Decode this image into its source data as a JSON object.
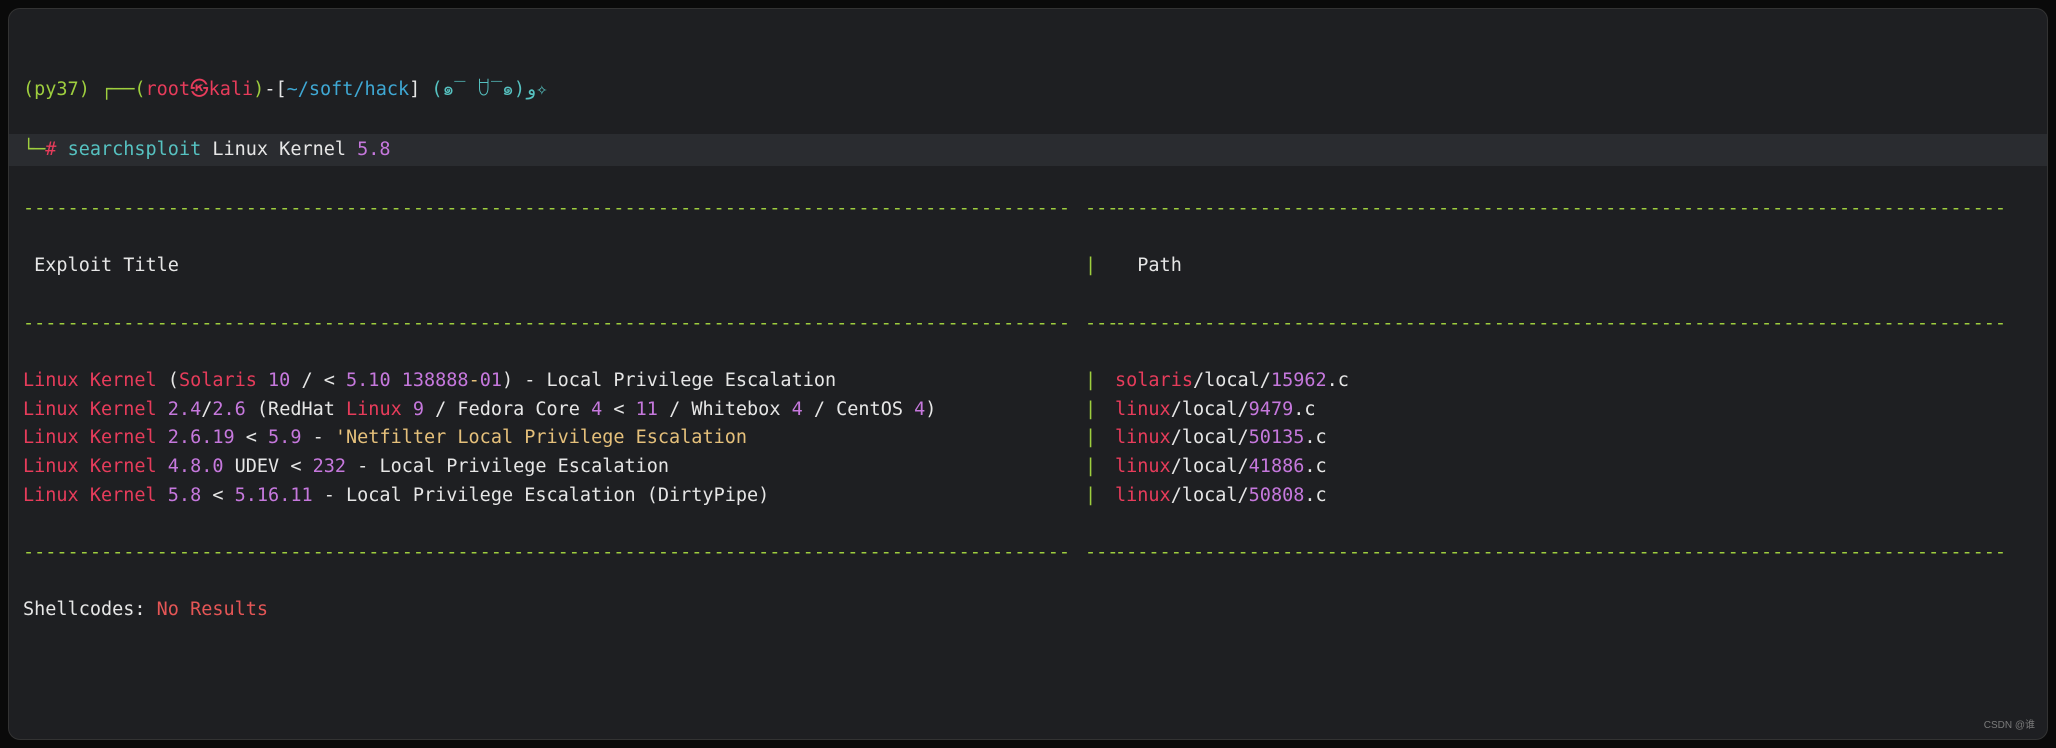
{
  "prompt": {
    "env": "(py37)",
    "box_top_left": "┌──",
    "paren_open": "(",
    "user": "root",
    "symbol": "㉿",
    "host": "kali",
    "paren_close": ")",
    "dash": "-",
    "path_open": "[",
    "path": "~/soft/hack",
    "path_close": "]",
    "face": " (๑‾ ꇴ‾๑)و✧",
    "box_bottom": "└─",
    "hash": "# ",
    "command": "searchsploit",
    "args_text": " Linux Kernel ",
    "args_version": "5.8"
  },
  "columns": {
    "title": " Exploit Title",
    "path": "  Path"
  },
  "sep_left": "| ",
  "rows": [
    {
      "title_parts": [
        {
          "t": "Linux Kernel",
          "c": "r"
        },
        {
          "t": " (",
          "c": "w"
        },
        {
          "t": "Solaris",
          "c": "r"
        },
        {
          "t": " ",
          "c": "w"
        },
        {
          "t": "10",
          "c": "p"
        },
        {
          "t": " / < ",
          "c": "w"
        },
        {
          "t": "5.10",
          "c": "p"
        },
        {
          "t": " ",
          "c": "w"
        },
        {
          "t": "138888",
          "c": "p"
        },
        {
          "t": "-",
          "c": "y"
        },
        {
          "t": "01",
          "c": "p"
        },
        {
          "t": ") - Local Privilege Escalation",
          "c": "w"
        }
      ],
      "path_parts": [
        {
          "t": "solaris",
          "c": "r"
        },
        {
          "t": "/local/",
          "c": "w"
        },
        {
          "t": "15962",
          "c": "p"
        },
        {
          "t": ".c",
          "c": "w"
        }
      ]
    },
    {
      "title_parts": [
        {
          "t": "Linux Kernel",
          "c": "r"
        },
        {
          "t": " ",
          "c": "w"
        },
        {
          "t": "2.4",
          "c": "p"
        },
        {
          "t": "/",
          "c": "w"
        },
        {
          "t": "2.6",
          "c": "p"
        },
        {
          "t": " (RedHat ",
          "c": "w"
        },
        {
          "t": "Linux",
          "c": "r"
        },
        {
          "t": " ",
          "c": "w"
        },
        {
          "t": "9",
          "c": "p"
        },
        {
          "t": " / Fedora Core ",
          "c": "w"
        },
        {
          "t": "4",
          "c": "p"
        },
        {
          "t": " < ",
          "c": "w"
        },
        {
          "t": "11",
          "c": "p"
        },
        {
          "t": " / Whitebox ",
          "c": "w"
        },
        {
          "t": "4",
          "c": "p"
        },
        {
          "t": " / CentOS ",
          "c": "w"
        },
        {
          "t": "4",
          "c": "p"
        },
        {
          "t": ")",
          "c": "w"
        }
      ],
      "path_parts": [
        {
          "t": "linux",
          "c": "r"
        },
        {
          "t": "/local/",
          "c": "w"
        },
        {
          "t": "9479",
          "c": "p"
        },
        {
          "t": ".c",
          "c": "w"
        }
      ]
    },
    {
      "title_parts": [
        {
          "t": "Linux Kernel",
          "c": "r"
        },
        {
          "t": " ",
          "c": "w"
        },
        {
          "t": "2.6.19",
          "c": "p"
        },
        {
          "t": " < ",
          "c": "w"
        },
        {
          "t": "5.9",
          "c": "p"
        },
        {
          "t": " - ",
          "c": "w"
        },
        {
          "t": "'Netfilter Local Privilege Escalation",
          "c": "y"
        }
      ],
      "path_parts": [
        {
          "t": "linux",
          "c": "r"
        },
        {
          "t": "/local/",
          "c": "w"
        },
        {
          "t": "50135",
          "c": "p"
        },
        {
          "t": ".c",
          "c": "w"
        }
      ]
    },
    {
      "title_parts": [
        {
          "t": "Linux Kernel",
          "c": "r"
        },
        {
          "t": " ",
          "c": "w"
        },
        {
          "t": "4.8.0",
          "c": "p"
        },
        {
          "t": " UDEV < ",
          "c": "w"
        },
        {
          "t": "232",
          "c": "p"
        },
        {
          "t": " - Local Privilege Escalation",
          "c": "w"
        }
      ],
      "path_parts": [
        {
          "t": "linux",
          "c": "r"
        },
        {
          "t": "/local/",
          "c": "w"
        },
        {
          "t": "41886",
          "c": "p"
        },
        {
          "t": ".c",
          "c": "w"
        }
      ]
    },
    {
      "title_parts": [
        {
          "t": "Linux Kernel",
          "c": "r"
        },
        {
          "t": " ",
          "c": "w"
        },
        {
          "t": "5.8",
          "c": "p"
        },
        {
          "t": " < ",
          "c": "w"
        },
        {
          "t": "5.16.11",
          "c": "p"
        },
        {
          "t": " - Local Privilege Escalation (DirtyPipe)",
          "c": "w"
        }
      ],
      "path_parts": [
        {
          "t": "linux",
          "c": "r"
        },
        {
          "t": "/local/",
          "c": "w"
        },
        {
          "t": "50808",
          "c": "p"
        },
        {
          "t": ".c",
          "c": "w"
        }
      ]
    }
  ],
  "footer": {
    "label": "Shellcodes: ",
    "value": "No Results"
  },
  "watermark": "CSDN @谁"
}
